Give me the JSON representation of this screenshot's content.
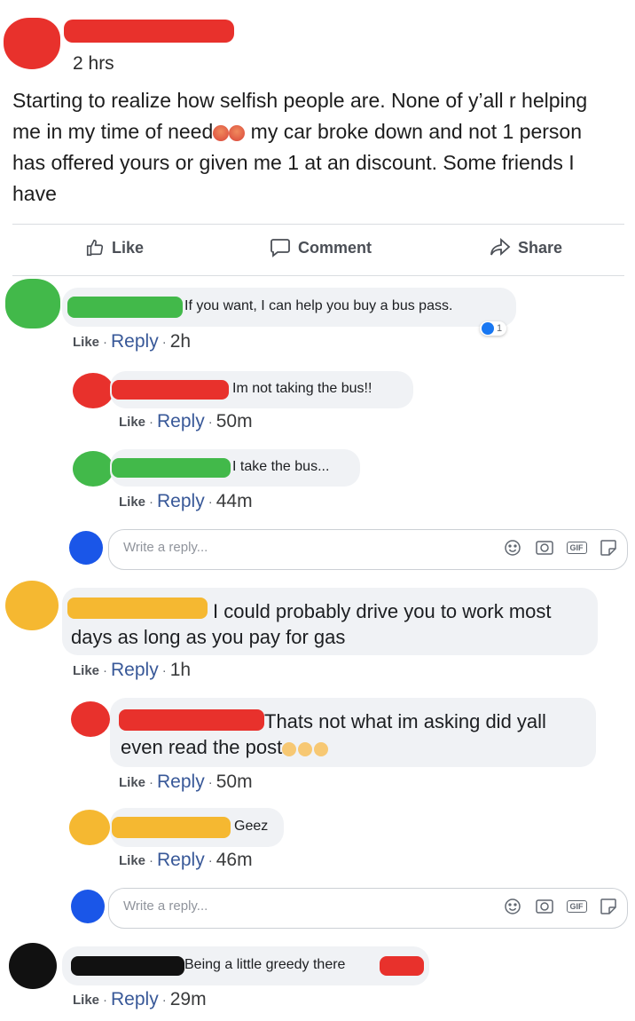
{
  "post": {
    "time": "2 hrs",
    "text_before_emoji": "Starting to realize how selfish people are. None of y’all r helping me in my time of need",
    "text_after_emoji": " my car broke down and not 1 person has offered yours or given me 1 at an discount. Some friends I have"
  },
  "actions": {
    "like": "Like",
    "comment": "Comment",
    "share": "Share"
  },
  "comments": [
    {
      "text": "If you want, I can help you buy a bus pass.",
      "like": "Like",
      "reply": "Reply",
      "time": "2h",
      "reaction_count": "1"
    },
    {
      "text": "Im not taking the bus!!",
      "like": "Like",
      "reply": "Reply",
      "time": "50m"
    },
    {
      "text": "I take the bus...",
      "like": "Like",
      "reply": "Reply",
      "time": "44m"
    },
    {
      "text": "I could probably drive you to work most days as long as you pay for gas",
      "like": "Like",
      "reply": "Reply",
      "time": "1h"
    },
    {
      "text": "Thats not what im asking did yall even read the post",
      "like": "Like",
      "reply": "Reply",
      "time": "50m"
    },
    {
      "text": "Geez",
      "like": "Like",
      "reply": "Reply",
      "time": "46m"
    },
    {
      "text": "Being a little greedy there",
      "like": "Like",
      "reply": "Reply",
      "time": "29m"
    }
  ],
  "write_reply": {
    "placeholder": "Write a reply...",
    "gif_label": "GIF"
  },
  "colors": {
    "red": "#e8312c",
    "green": "#42b94a",
    "blue": "#1a56e8",
    "yellow": "#f5b831",
    "black": "#111111",
    "link": "#385898"
  },
  "icons": [
    "like-icon",
    "comment-icon",
    "share-icon",
    "angry-emoji-icon",
    "smiley-icon",
    "camera-icon",
    "gif-icon",
    "sticker-icon",
    "like-reaction-icon"
  ]
}
